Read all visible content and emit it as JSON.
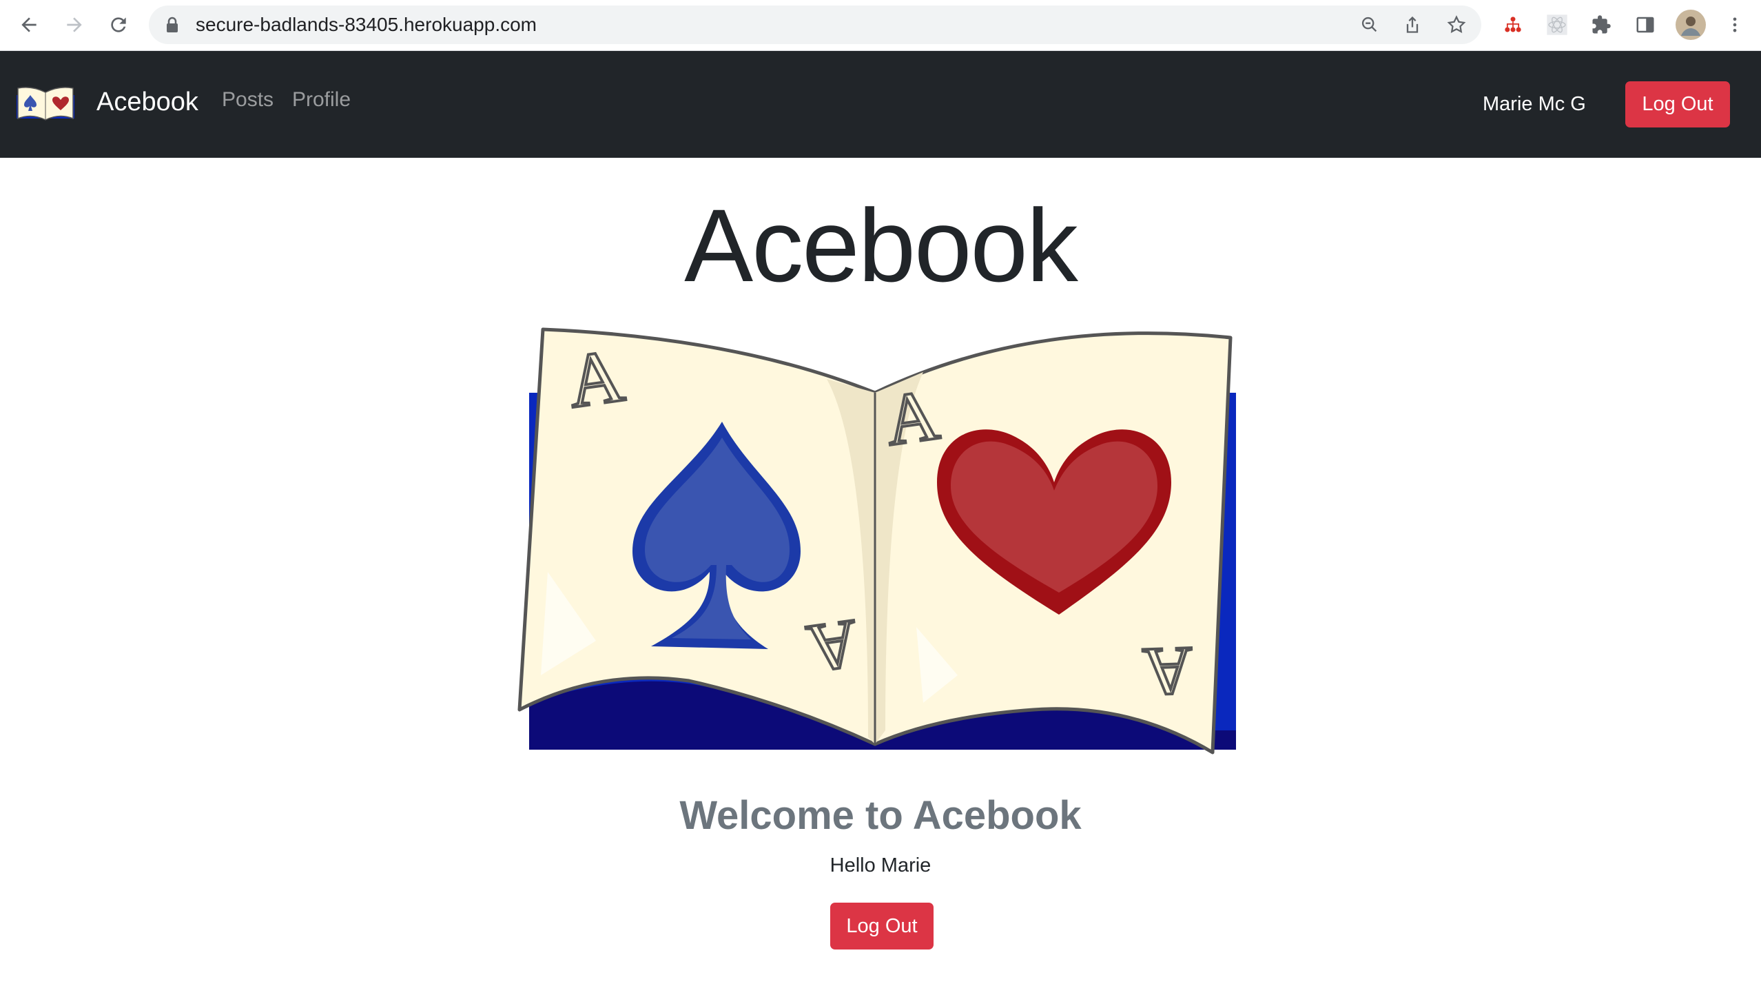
{
  "browser": {
    "url": "secure-badlands-83405.herokuapp.com"
  },
  "navbar": {
    "brand": "Acebook",
    "links": [
      "Posts",
      "Profile"
    ],
    "user": "Marie Mc G",
    "logout_label": "Log Out"
  },
  "main": {
    "title": "Acebook",
    "welcome": "Welcome to Acebook",
    "greeting": "Hello Marie",
    "logout_label": "Log Out"
  },
  "colors": {
    "navbar_bg": "#212529",
    "danger": "#dc3545",
    "book_blue": "#0a28be",
    "spade_blue": "#3a55b0",
    "heart_red": "#b0292e"
  }
}
